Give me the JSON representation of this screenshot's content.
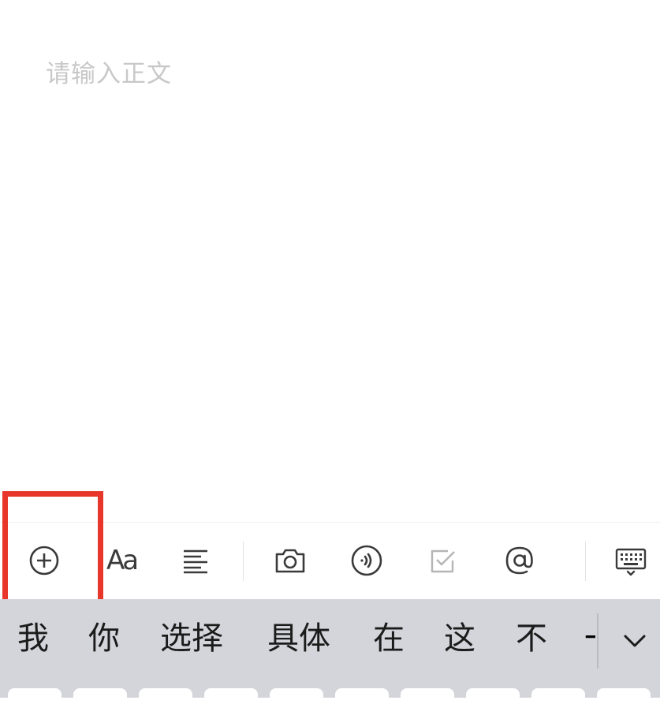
{
  "editor": {
    "placeholder": "请输入正文"
  },
  "toolbar": {
    "icons": {
      "add": "plus-circle-icon",
      "font": "font-size-icon",
      "align": "align-left-icon",
      "camera": "camera-icon",
      "audio": "audio-icon",
      "checkbox": "checkbox-icon",
      "mention": "at-sign-icon",
      "keyboard": "keyboard-icon"
    },
    "font_label": "Aa"
  },
  "candidates": [
    "我",
    "你",
    "选择",
    "具体",
    "在",
    "这",
    "不",
    "一"
  ],
  "colors": {
    "highlight": "#e8362b",
    "candidate_bar": "#d3d5da",
    "placeholder": "#c8c8c8"
  }
}
